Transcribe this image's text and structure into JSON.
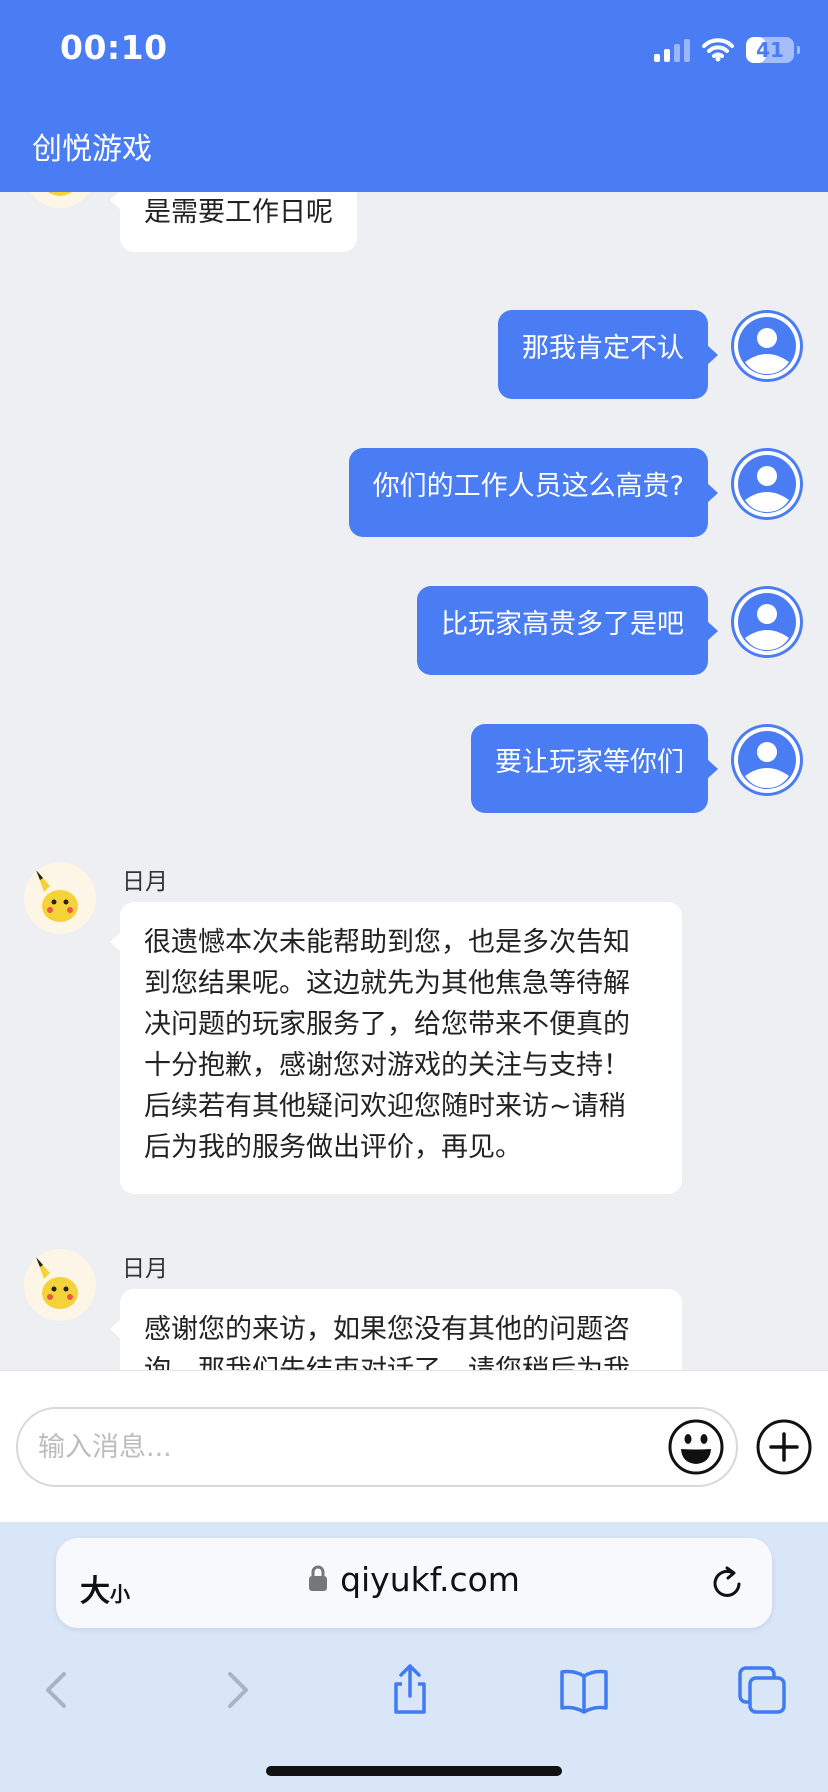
{
  "status_bar": {
    "time": "00:10",
    "battery": "41"
  },
  "header": {
    "title": "创悦游戏"
  },
  "chat": {
    "partial_agent_message": "是需要工作日呢",
    "user_messages": [
      "那我肯定不认",
      "你们的工作人员这么高贵?",
      "比玩家高贵多了是吧",
      "要让玩家等你们"
    ],
    "agent_messages": [
      {
        "sender": "日月",
        "lines": [
          "很遗憾本次未能帮助到您，也是多次告知",
          "到您结果呢。这边就先为其他焦急等待解",
          "决问题的玩家服务了，给您带来不便真的",
          "十分抱歉，感谢您对游戏的关注与支持！",
          "后续若有其他疑问欢迎您随时来访~请稍",
          "后为我的服务做出评价，再见。"
        ]
      },
      {
        "sender": "日月",
        "lines": [
          "感谢您的来访，如果您没有其他的问题咨",
          "询，那我们先结束对话了，请您稍后为我"
        ]
      }
    ]
  },
  "input": {
    "placeholder": "输入消息...",
    "value": ""
  },
  "browser": {
    "text_size_label": "大",
    "text_size_small": "小",
    "url": "qiyukf.com"
  },
  "colors": {
    "accent": "#4a7cf3",
    "chat_bg": "#eeeff3",
    "browser_bg": "#d9e6f8"
  },
  "icons": [
    "signal-icon",
    "wifi-icon",
    "battery-icon",
    "user-avatar-icon",
    "agent-avatar-icon",
    "emoji-icon",
    "plus-icon",
    "lock-icon",
    "reload-icon",
    "back-icon",
    "forward-icon",
    "share-icon",
    "bookmarks-icon",
    "tabs-icon"
  ]
}
